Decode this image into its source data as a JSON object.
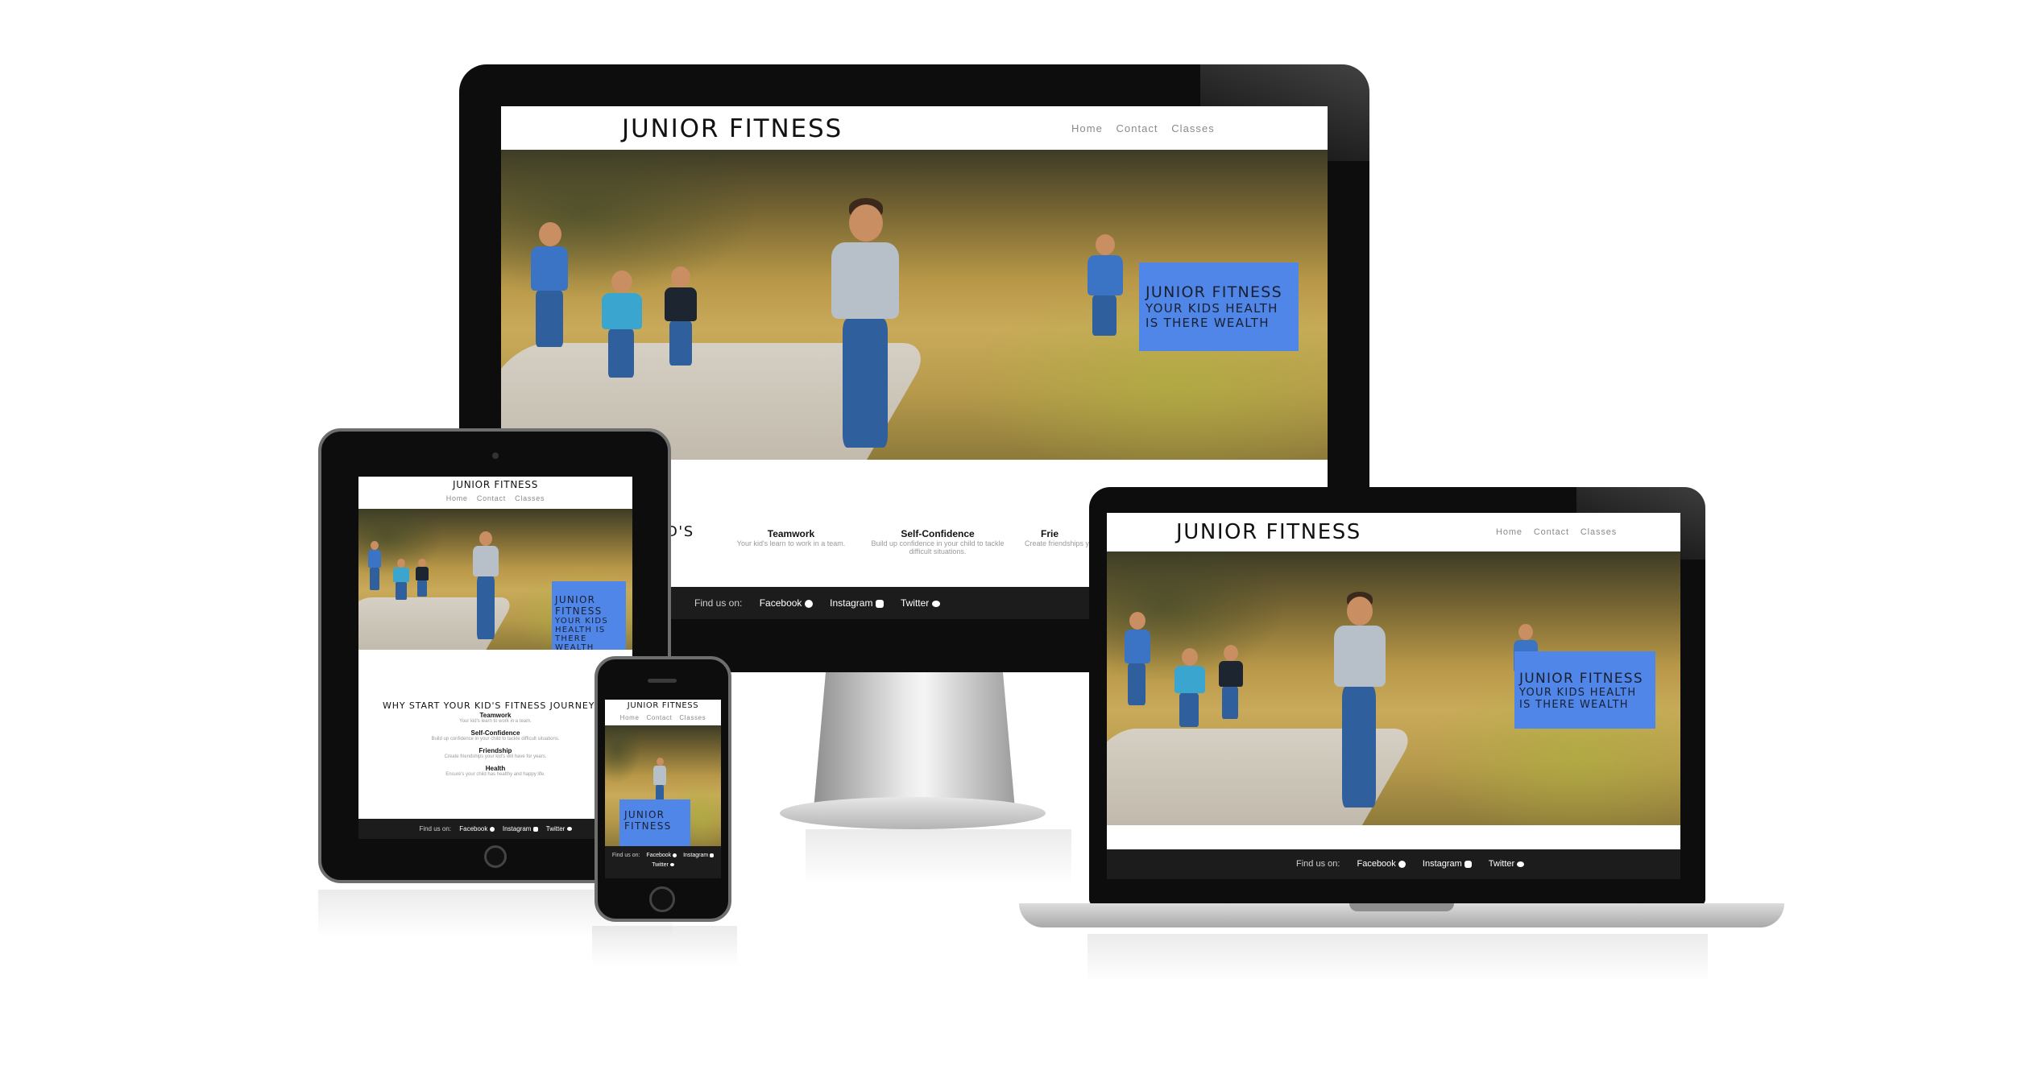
{
  "site": {
    "brand": "JUNIOR FITNESS",
    "nav": [
      "Home",
      "Contact",
      "Classes"
    ],
    "hero_title": "JUNIOR FITNESS",
    "hero_tagline_line1": "YOUR KIDS HEALTH",
    "hero_tagline_line2": "IS THERE WEALTH",
    "hero_tagline_narrow": [
      "YOUR KIDS",
      "HEALTH IS",
      "THERE",
      "WEALTH"
    ],
    "section_title": "WHY START YOUR KID'S FITNESS JOURNEY",
    "section_title_fragment": "D'S",
    "features": [
      {
        "heading": "Teamwork",
        "text": "Your kid's learn to work in a team."
      },
      {
        "heading": "Self-Confidence",
        "text": "Build up confidence in your child to tackle difficult situations."
      },
      {
        "heading": "Friendship",
        "text": "Create friendships your kid's will have for years."
      },
      {
        "heading": "Health",
        "text": "Ensure's your child has healthy and happy life."
      }
    ],
    "feature_cropped_heading": "Frie",
    "feature_cropped_text": "Create friendships yo",
    "footer": {
      "label": "Find us on:",
      "links": [
        "Facebook",
        "Instagram",
        "Twitter"
      ]
    }
  },
  "icons": [
    "facebook-icon",
    "instagram-icon",
    "twitter-icon"
  ],
  "colors": {
    "badge": "#4f86e8",
    "footer": "#1c1c1c",
    "frame": "#0d0d0d"
  }
}
